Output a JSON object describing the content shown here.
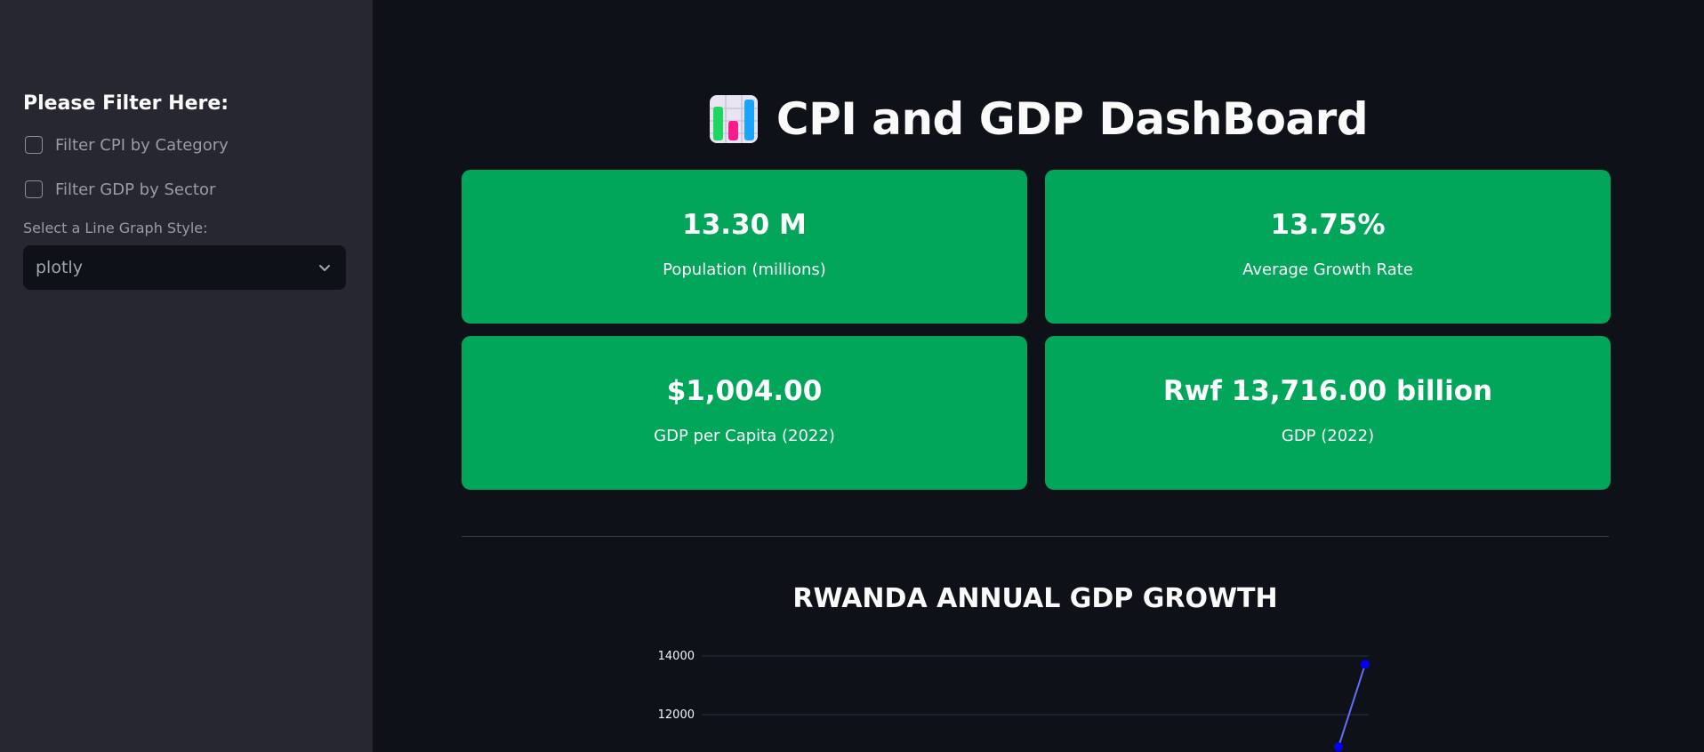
{
  "sidebar": {
    "title": "Please Filter Here:",
    "checkboxes": [
      {
        "label": "Filter CPI by Category",
        "checked": false
      },
      {
        "label": "Filter GDP by Sector",
        "checked": false
      }
    ],
    "select_label": "Select a Line Graph Style:",
    "select_value": "plotly"
  },
  "header": {
    "title": "CPI and GDP DashBoard",
    "icon": "bar-chart-icon"
  },
  "cards": [
    {
      "value": "13.30 M",
      "label": "Population (millions)"
    },
    {
      "value": "13.75%",
      "label": "Average Growth Rate"
    },
    {
      "value": "$1,004.00",
      "label": "GDP per Capita (2022)"
    },
    {
      "value": "Rwf 13,716.00 billion",
      "label": "GDP (2022)"
    }
  ],
  "colors": {
    "card_bg": "#02a65a",
    "page_bg": "#0e1117",
    "sidebar_bg": "#262730",
    "line": "#636efa",
    "marker": "#0000ff"
  },
  "chart_data": {
    "type": "line",
    "title": "RWANDA ANNUAL GDP GROWTH",
    "yticks": [
      12000,
      14000
    ],
    "ylim_visible": [
      11000,
      14400
    ],
    "series": [
      {
        "values": [
          10900,
          13716
        ]
      }
    ]
  }
}
